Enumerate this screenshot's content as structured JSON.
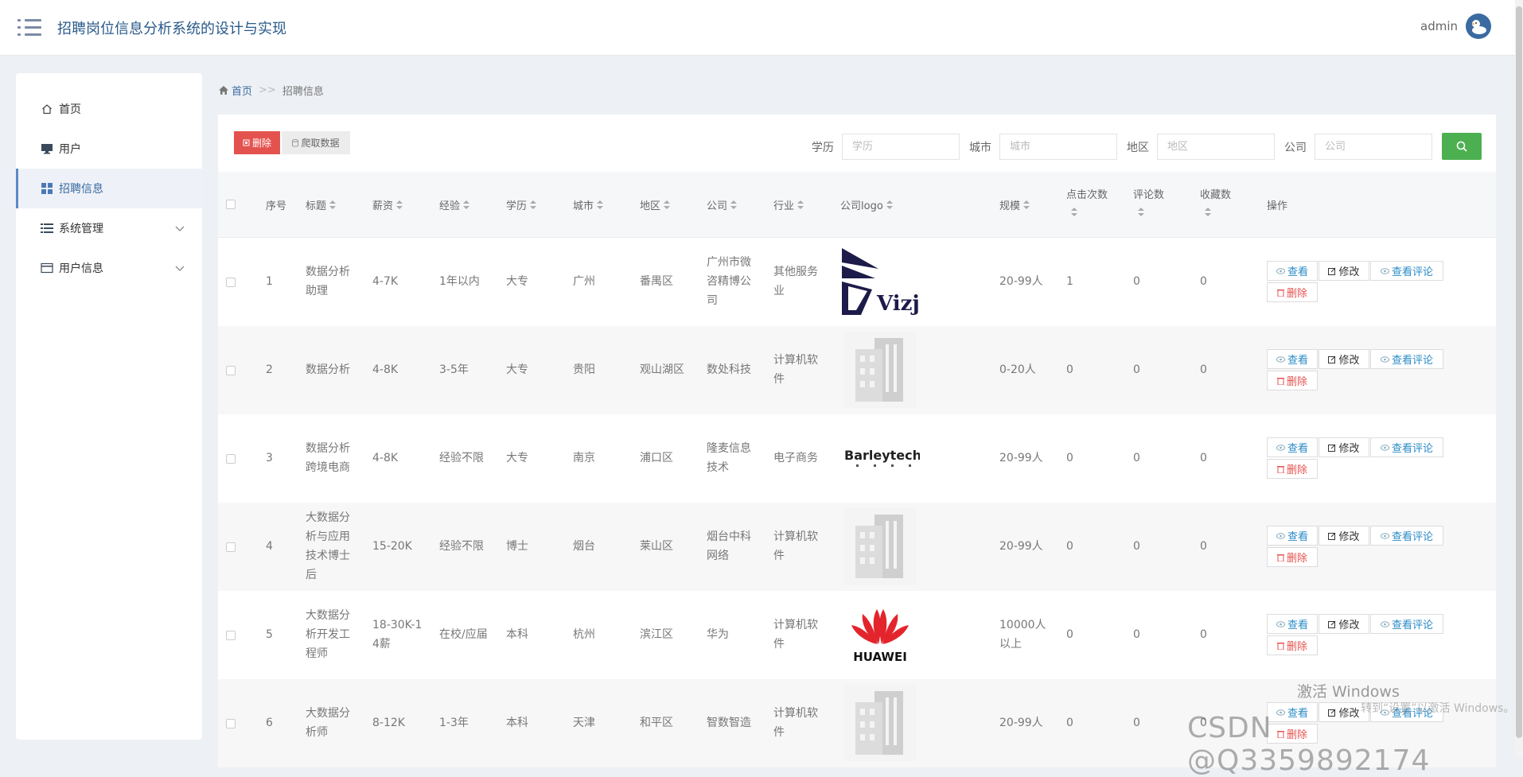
{
  "header": {
    "title": "招聘岗位信息分析系统的设计与实现",
    "username": "admin"
  },
  "sidebar": {
    "items": [
      {
        "label": "首页",
        "icon": "home-icon"
      },
      {
        "label": "用户",
        "icon": "monitor-icon"
      },
      {
        "label": "招聘信息",
        "icon": "grid-icon",
        "active": true
      },
      {
        "label": "系统管理",
        "icon": "list-icon",
        "expandable": true
      },
      {
        "label": "用户信息",
        "icon": "card-icon",
        "expandable": true
      }
    ]
  },
  "breadcrumb": {
    "home": "首页",
    "separator": ">>",
    "current": "招聘信息"
  },
  "toolbar": {
    "delete_label": "删除",
    "crawl_label": "爬取数据",
    "filters": [
      {
        "label": "学历",
        "placeholder": "学历"
      },
      {
        "label": "城市",
        "placeholder": "城市"
      },
      {
        "label": "地区",
        "placeholder": "地区"
      },
      {
        "label": "公司",
        "placeholder": "公司"
      }
    ]
  },
  "table": {
    "columns": [
      "序号",
      "标题",
      "薪资",
      "经验",
      "学历",
      "城市",
      "地区",
      "公司",
      "行业",
      "公司logo",
      "规模",
      "点击次数",
      "评论数",
      "收藏数",
      "操作"
    ],
    "actions": {
      "view": "查看",
      "edit": "修改",
      "comments": "查看评论",
      "delete": "删除"
    },
    "rows": [
      {
        "index": "1",
        "title": [
          "数据分析",
          "助理"
        ],
        "salary": [
          "4-7K"
        ],
        "experience": "1年以内",
        "education": "大专",
        "city": "广州",
        "district": "番禺区",
        "company": [
          "广州市微",
          "咨精博公",
          "司"
        ],
        "industry": [
          "其他服务",
          "业"
        ],
        "logo": "vizji",
        "logo_text": "Vizji",
        "scale": [
          "20-99人"
        ],
        "clicks": "1",
        "comments": "0",
        "favorites": "0"
      },
      {
        "index": "2",
        "title": [
          "数据分析"
        ],
        "salary": [
          "4-8K"
        ],
        "experience": "3-5年",
        "education": "大专",
        "city": "贵阳",
        "district": "观山湖区",
        "company": [
          "数处科技"
        ],
        "industry": [
          "计算机软",
          "件"
        ],
        "logo": "building",
        "logo_text": "",
        "scale": [
          "0-20人"
        ],
        "clicks": "0",
        "comments": "0",
        "favorites": "0"
      },
      {
        "index": "3",
        "title": [
          "数据分析",
          "跨境电商"
        ],
        "salary": [
          "4-8K"
        ],
        "experience": "经验不限",
        "education": "大专",
        "city": "南京",
        "district": "浦口区",
        "company": [
          "隆麦信息",
          "技术"
        ],
        "industry": [
          "电子商务"
        ],
        "logo": "barley",
        "logo_text": "Barleytech",
        "scale": [
          "20-99人"
        ],
        "clicks": "0",
        "comments": "0",
        "favorites": "0"
      },
      {
        "index": "4",
        "title": [
          "大数据分",
          "析与应用",
          "技术博士",
          "后"
        ],
        "salary": [
          "15-20K"
        ],
        "experience": "经验不限",
        "education": "博士",
        "city": "烟台",
        "district": "莱山区",
        "company": [
          "烟台中科",
          "网络"
        ],
        "industry": [
          "计算机软",
          "件"
        ],
        "logo": "building",
        "logo_text": "",
        "scale": [
          "20-99人"
        ],
        "clicks": "0",
        "comments": "0",
        "favorites": "0"
      },
      {
        "index": "5",
        "title": [
          "大数据分",
          "析开发工",
          "程师"
        ],
        "salary": [
          "18-30K-1",
          "4薪"
        ],
        "experience": "在校/应届",
        "education": "本科",
        "city": "杭州",
        "district": "滨江区",
        "company": [
          "华为"
        ],
        "industry": [
          "计算机软",
          "件"
        ],
        "logo": "huawei",
        "logo_text": "HUAWEI",
        "scale": [
          "10000人",
          "以上"
        ],
        "clicks": "0",
        "comments": "0",
        "favorites": "0"
      },
      {
        "index": "6",
        "title": [
          "大数据分",
          "析师"
        ],
        "salary": [
          "8-12K"
        ],
        "experience": "1-3年",
        "education": "本科",
        "city": "天津",
        "district": "和平区",
        "company": [
          "智数智造"
        ],
        "industry": [
          "计算机软",
          "件"
        ],
        "logo": "building",
        "logo_text": "",
        "scale": [
          "20-99人"
        ],
        "clicks": "0",
        "comments": "0",
        "favorites": "0"
      }
    ]
  },
  "overlay": {
    "activate": "激活 Windows",
    "activate_sub": "转到“设置”以激活 Windows。",
    "csdn": "CSDN @Q3359892174"
  }
}
